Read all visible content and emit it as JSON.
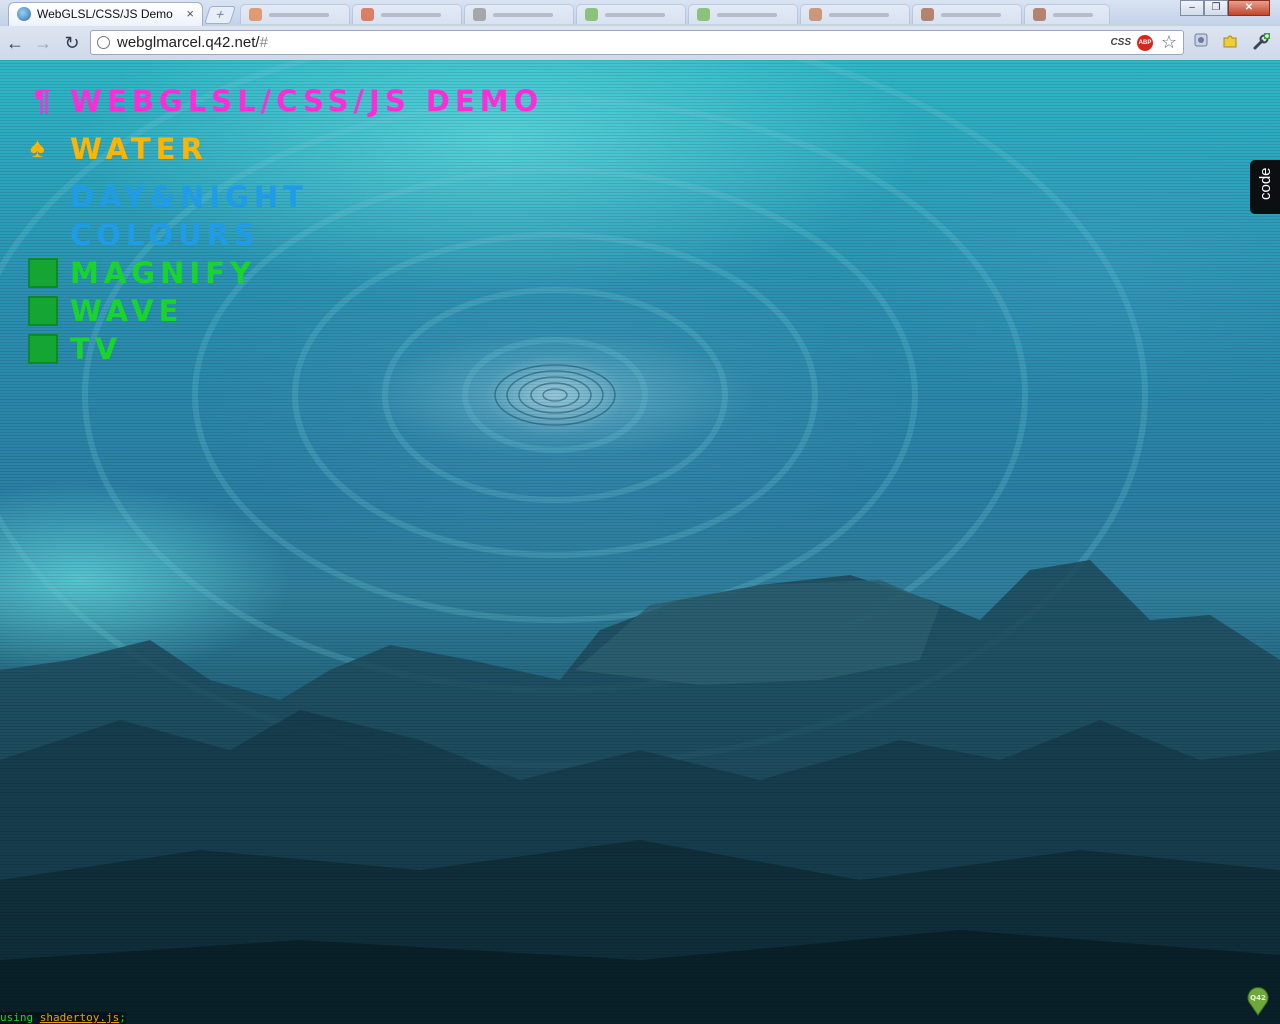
{
  "browser": {
    "active_tab": {
      "title": "WebGLSL/CSS/JS Demo",
      "close": "×"
    },
    "new_tab": "+",
    "window_controls": {
      "minimize": "–",
      "restore": "❐",
      "close": "✕"
    },
    "nav": {
      "back": "←",
      "forward": "→",
      "reload": "↻"
    },
    "address": {
      "host": "webglmarcel.q42.net/",
      "path": "#"
    },
    "ext_css_label": "CSS",
    "ext_abp_label": "ABP"
  },
  "page": {
    "menu": {
      "title_mark": "¶",
      "title": "WebGLSL/CSS/JS Demo",
      "water_mark": "♠",
      "water": "Water",
      "day_night": "Day&Night",
      "colours": "Colours",
      "magnify": "Magnify",
      "wave": "Wave",
      "tv": "TV"
    },
    "code_tab": "code",
    "footer": {
      "prefix": "using ",
      "lib": "shadertoy.js",
      "suffix": ";"
    },
    "q42_badge": "Q42"
  },
  "colors": {
    "title": "#ff2bd6",
    "active_item": "#ffb400",
    "item_blue": "#1f9be8",
    "item_green": "#19d52b",
    "checkbox": "#14a532"
  }
}
